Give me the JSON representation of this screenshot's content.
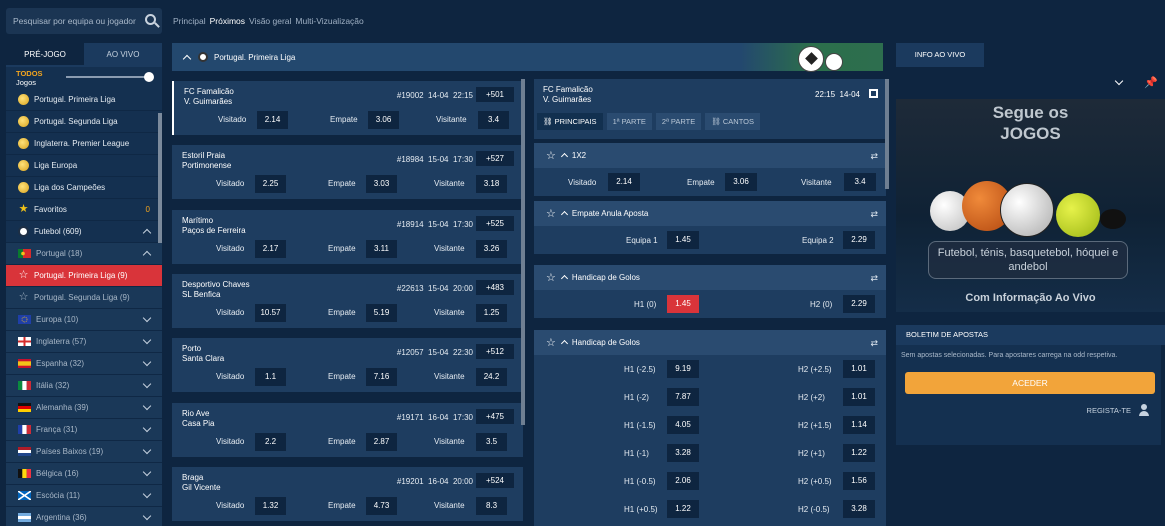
{
  "search": {
    "placeholder": "Pesquisar por equipa ou jogador"
  },
  "top_nav": [
    "Principal",
    "Próximos",
    "Visão geral",
    "Multi-Vizualização"
  ],
  "sidebar": {
    "tabs": [
      "PRÉ-JOGO",
      "AO VIVO"
    ],
    "todos": "TODOS",
    "jogos": "Jogos",
    "favorites": [
      {
        "label": "Portugal. Primeira Liga"
      },
      {
        "label": "Portugal. Segunda Liga"
      },
      {
        "label": "Inglaterra. Premier League"
      },
      {
        "label": "Liga Europa"
      },
      {
        "label": "Liga dos Campeões"
      }
    ],
    "favoritos": {
      "label": "Favoritos",
      "count": "0"
    },
    "futebol": "Futebol (609)",
    "portugal": "Portugal (18)",
    "pt_leagues": [
      "Portugal. Primeira Liga (9)",
      "Portugal. Segunda Liga (9)"
    ],
    "countries": [
      "Europa (10)",
      "Inglaterra (57)",
      "Espanha (32)",
      "Itália (32)",
      "Alemanha (39)",
      "França (31)",
      "Países Baixos (19)",
      "Bélgica (16)",
      "Escócia (11)",
      "Argentina (36)"
    ]
  },
  "league_header": "Portugal. Primeira Liga",
  "events": [
    {
      "home": "FC Famalicão",
      "away": "V. Guimarães",
      "id": "#19002",
      "date": "14-04",
      "time": "22:15",
      "more": "+501",
      "odds": [
        "2.14",
        "3.06",
        "3.4"
      ]
    },
    {
      "home": "Estoril Praia",
      "away": "Portimonense",
      "id": "#18984",
      "date": "15-04",
      "time": "17:30",
      "more": "+527",
      "odds": [
        "2.25",
        "3.03",
        "3.18"
      ]
    },
    {
      "home": "Marítimo",
      "away": "Paços de Ferreira",
      "id": "#18914",
      "date": "15-04",
      "time": "17:30",
      "more": "+525",
      "odds": [
        "2.17",
        "3.11",
        "3.26"
      ]
    },
    {
      "home": "Desportivo Chaves",
      "away": "SL Benfica",
      "id": "#22613",
      "date": "15-04",
      "time": "20:00",
      "more": "+483",
      "odds": [
        "10.57",
        "5.19",
        "1.25"
      ]
    },
    {
      "home": "Porto",
      "away": "Santa Clara",
      "id": "#12057",
      "date": "15-04",
      "time": "22:30",
      "more": "+512",
      "odds": [
        "1.1",
        "7.16",
        "24.2"
      ]
    },
    {
      "home": "Rio Ave",
      "away": "Casa Pia",
      "id": "#19171",
      "date": "16-04",
      "time": "17:30",
      "more": "+475",
      "odds": [
        "2.2",
        "2.87",
        "3.5"
      ]
    },
    {
      "home": "Braga",
      "away": "Gil Vicente",
      "id": "#19201",
      "date": "16-04",
      "time": "20:00",
      "more": "+524",
      "odds": [
        "1.32",
        "4.73",
        "8.3"
      ]
    }
  ],
  "odds_labels": {
    "home": "Visitado",
    "draw": "Empate",
    "away": "Visitante"
  },
  "detail": {
    "home": "FC Famalicão",
    "away": "V. Guimarães",
    "time": "22:15",
    "date": "14-04",
    "tabs": [
      "PRINCIPAIS",
      "1ª PARTE",
      "2ª PARTE",
      "CANTOS"
    ],
    "m1x2": {
      "title": "1X2",
      "labels": [
        "Visitado",
        "Empate",
        "Visitante"
      ],
      "values": [
        "2.14",
        "3.06",
        "3.4"
      ]
    },
    "dnb": {
      "title": "Empate Anula Aposta",
      "labels": [
        "Equipa 1",
        "Equipa 2"
      ],
      "values": [
        "1.45",
        "2.29"
      ]
    },
    "hcap1": {
      "title": "Handicap de Golos",
      "labels": [
        "H1 (0)",
        "H2 (0)"
      ],
      "values": [
        "1.45",
        "2.29"
      ]
    },
    "hcap2": {
      "title": "Handicap de Golos",
      "rows": [
        {
          "l1": "H1 (-2.5)",
          "v1": "9.19",
          "l2": "H2 (+2.5)",
          "v2": "1.01"
        },
        {
          "l1": "H1 (-2)",
          "v1": "7.87",
          "l2": "H2 (+2)",
          "v2": "1.01"
        },
        {
          "l1": "H1 (-1.5)",
          "v1": "4.05",
          "l2": "H2 (+1.5)",
          "v2": "1.14"
        },
        {
          "l1": "H1 (-1)",
          "v1": "3.28",
          "l2": "H2 (+1)",
          "v2": "1.22"
        },
        {
          "l1": "H1 (-0.5)",
          "v1": "2.06",
          "l2": "H2 (+0.5)",
          "v2": "1.56"
        },
        {
          "l1": "H1 (+0.5)",
          "v1": "1.22",
          "l2": "H2 (-0.5)",
          "v2": "3.28"
        }
      ]
    }
  },
  "right": {
    "tab": "INFO AO VIVO",
    "banner_line1": "Segue os",
    "banner_line2": "JOGOS",
    "banner_desc": "Futebol, ténis, basquetebol, hóquei e andebol",
    "banner_foot": "Com Informação Ao Vivo",
    "betslip_title": "BOLETIM DE APOSTAS",
    "betslip_msg": "Sem apostas selecionadas. Para apostares carrega na odd respetiva.",
    "login_btn": "ACEDER",
    "register": "REGISTA-TE"
  },
  "colors": {
    "bg": "#0e2540",
    "accent": "#f2a43a",
    "active_red": "#d9343a"
  }
}
